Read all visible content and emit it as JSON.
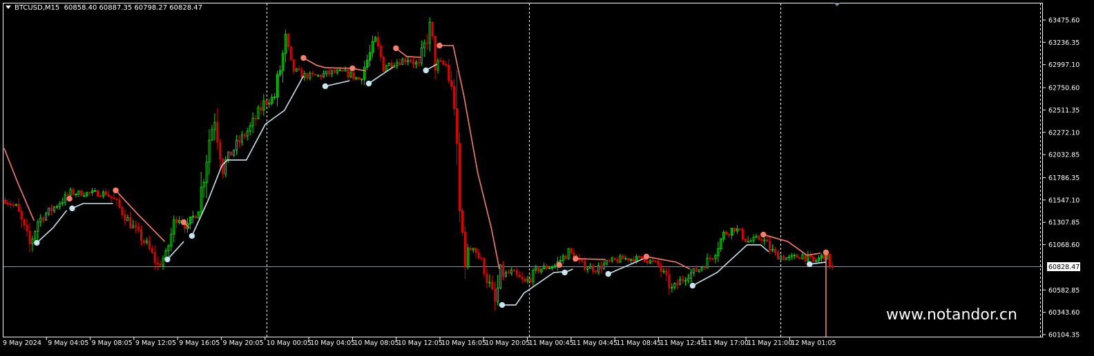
{
  "header": {
    "symbol": "BTCUSD,M15",
    "ohlc": "60858.40 60887.35 60798.27 60828.47"
  },
  "watermark": "www.notandor.cn",
  "colors": {
    "background": "#000000",
    "bull": "#00e000",
    "bear": "#e00000",
    "upper_stop": "#fa7f6a",
    "lower_stop": "#c8e6f0",
    "axis": "#ffffff",
    "price_line": "#8a97a8"
  },
  "chart_data": {
    "type": "candlestick",
    "symbol": "BTCUSD",
    "timeframe": "M15",
    "ylim": [
      60104.35,
      63475.6
    ],
    "current_price": "60828.47",
    "y_ticks": [
      "63475.60",
      "63236.35",
      "62997.10",
      "62750.60",
      "62511.35",
      "62272.10",
      "62032.85",
      "61786.35",
      "61547.10",
      "61307.85",
      "61068.60",
      "60582.85",
      "60343.60",
      "60104.35"
    ],
    "x_ticks": [
      "9 May 2024",
      "9 May 04:05",
      "9 May 08:05",
      "9 May 12:05",
      "9 May 16:05",
      "9 May 20:05",
      "10 May 00:05",
      "10 May 04:05",
      "10 May 08:05",
      "10 May 12:05",
      "10 May 16:05",
      "10 May 20:05",
      "11 May 00:45",
      "11 May 04:45",
      "11 May 08:45",
      "11 May 12:45",
      "11 May 17:00",
      "11 May 21:00",
      "12 May 01:05"
    ],
    "candle_count": 305,
    "close_path": [
      [
        0,
        61546
      ],
      [
        4,
        61472
      ],
      [
        9,
        61066
      ],
      [
        12,
        61324
      ],
      [
        18,
        61472
      ],
      [
        24,
        61620
      ],
      [
        29,
        61620
      ],
      [
        37,
        61620
      ],
      [
        40,
        61546
      ],
      [
        47,
        61250
      ],
      [
        52,
        61066
      ],
      [
        56,
        60844
      ],
      [
        59,
        60955
      ],
      [
        63,
        61398
      ],
      [
        67,
        61250
      ],
      [
        71,
        61472
      ],
      [
        75,
        62211
      ],
      [
        77,
        62433
      ],
      [
        80,
        61916
      ],
      [
        85,
        62137
      ],
      [
        90,
        62322
      ],
      [
        95,
        62581
      ],
      [
        99,
        62655
      ],
      [
        103,
        63246
      ],
      [
        105,
        62951
      ],
      [
        110,
        62877
      ],
      [
        115,
        62877
      ],
      [
        120,
        62914
      ],
      [
        125,
        62914
      ],
      [
        130,
        62840
      ],
      [
        136,
        63246
      ],
      [
        139,
        62988
      ],
      [
        144,
        63025
      ],
      [
        148,
        63062
      ],
      [
        152,
        62988
      ],
      [
        156,
        63394
      ],
      [
        158,
        63025
      ],
      [
        162,
        62988
      ],
      [
        165,
        62581
      ],
      [
        166,
        61620
      ],
      [
        169,
        60955
      ],
      [
        172,
        61066
      ],
      [
        176,
        60807
      ],
      [
        180,
        60437
      ],
      [
        182,
        60733
      ],
      [
        186,
        60770
      ],
      [
        191,
        60659
      ],
      [
        196,
        60807
      ],
      [
        202,
        60844
      ],
      [
        207,
        60992
      ],
      [
        212,
        60844
      ],
      [
        217,
        60807
      ],
      [
        222,
        60881
      ],
      [
        227,
        60918
      ],
      [
        235,
        60918
      ],
      [
        240,
        60844
      ],
      [
        245,
        60585
      ],
      [
        250,
        60733
      ],
      [
        255,
        60807
      ],
      [
        260,
        60955
      ],
      [
        264,
        61177
      ],
      [
        268,
        61250
      ],
      [
        273,
        61102
      ],
      [
        278,
        61140
      ],
      [
        283,
        60955
      ],
      [
        288,
        60918
      ],
      [
        293,
        60955
      ],
      [
        297,
        60881
      ],
      [
        301,
        60955
      ],
      [
        304,
        60828
      ]
    ],
    "upper_stop_segments": [
      {
        "dot": false,
        "points": [
          [
            0,
            62101
          ],
          [
            5,
            61731
          ],
          [
            11,
            61324
          ]
        ]
      },
      {
        "dot": true,
        "points": [
          [
            24,
            61561
          ]
        ]
      },
      {
        "dot": true,
        "points": [
          [
            41,
            61650
          ],
          [
            49,
            61398
          ],
          [
            59,
            61102
          ]
        ]
      },
      {
        "dot": true,
        "points": [
          [
            66,
            61309
          ],
          [
            68,
            61250
          ]
        ]
      },
      {
        "dot": true,
        "points": [
          [
            110,
            63069
          ],
          [
            115,
            62988
          ],
          [
            118,
            62965
          ],
          [
            127,
            62958
          ]
        ]
      },
      {
        "dot": true,
        "points": [
          [
            128,
            62958
          ],
          [
            133,
            62929
          ]
        ]
      },
      {
        "dot": true,
        "points": [
          [
            144,
            63173
          ],
          [
            148,
            63084
          ],
          [
            153,
            63076
          ]
        ]
      },
      {
        "dot": true,
        "points": [
          [
            160,
            63202
          ],
          [
            165,
            63202
          ],
          [
            169,
            62655
          ],
          [
            174,
            61842
          ],
          [
            179,
            61250
          ],
          [
            182,
            60807
          ]
        ]
      },
      {
        "dot": true,
        "points": [
          [
            204,
            60851
          ]
        ]
      },
      {
        "dot": true,
        "points": [
          [
            210,
            60918
          ],
          [
            221,
            60910
          ]
        ]
      },
      {
        "dot": true,
        "points": [
          [
            236,
            60940
          ],
          [
            247,
            60881
          ],
          [
            252,
            60807
          ]
        ]
      },
      {
        "dot": true,
        "points": [
          [
            279,
            61176
          ],
          [
            288,
            61102
          ],
          [
            295,
            60955
          ],
          [
            300,
            60977
          ]
        ]
      },
      {
        "dot": true,
        "drop": true,
        "points": [
          [
            302,
            60985
          ]
        ]
      }
    ],
    "lower_stop_segments": [
      {
        "dot": true,
        "points": [
          [
            12,
            61088
          ],
          [
            18,
            61250
          ],
          [
            23,
            61435
          ]
        ]
      },
      {
        "dot": true,
        "points": [
          [
            25,
            61457
          ],
          [
            29,
            61509
          ],
          [
            40,
            61509
          ]
        ]
      },
      {
        "dot": true,
        "points": [
          [
            60,
            60910
          ],
          [
            66,
            61102
          ]
        ]
      },
      {
        "dot": true,
        "points": [
          [
            69,
            61162
          ],
          [
            75,
            61546
          ],
          [
            80,
            61916
          ],
          [
            82,
            61975
          ],
          [
            89,
            61975
          ],
          [
            96,
            62359
          ],
          [
            103,
            62507
          ],
          [
            110,
            62877
          ]
        ]
      },
      {
        "dot": true,
        "points": [
          [
            118,
            62766
          ],
          [
            127,
            62825
          ]
        ]
      },
      {
        "dot": true,
        "points": [
          [
            134,
            62795
          ],
          [
            143,
            62973
          ]
        ]
      },
      {
        "dot": true,
        "points": [
          [
            155,
            62936
          ],
          [
            159,
            63002
          ]
        ]
      },
      {
        "dot": true,
        "points": [
          [
            183,
            60422
          ],
          [
            188,
            60422
          ],
          [
            191,
            60548
          ],
          [
            202,
            60770
          ],
          [
            205,
            60777
          ]
        ]
      },
      {
        "dot": true,
        "points": [
          [
            206,
            60770
          ],
          [
            209,
            60807
          ]
        ]
      },
      {
        "dot": true,
        "points": [
          [
            222,
            60755
          ],
          [
            235,
            60918
          ]
        ]
      },
      {
        "dot": true,
        "points": [
          [
            253,
            60629
          ],
          [
            262,
            60770
          ],
          [
            273,
            61066
          ],
          [
            278,
            61066
          ],
          [
            281,
            60992
          ]
        ]
      },
      {
        "dot": true,
        "points": [
          [
            296,
            60859
          ],
          [
            302,
            60881
          ]
        ]
      }
    ]
  }
}
